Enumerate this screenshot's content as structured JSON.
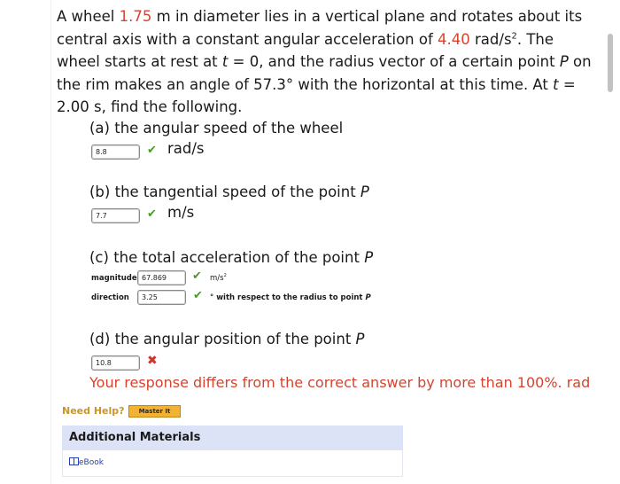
{
  "problem": {
    "p1": "A wheel ",
    "diameter": "1.75",
    "p2": " m in diameter lies in a vertical plane and rotates about its central axis with a constant angular acceleration of ",
    "alpha": "4.40",
    "p3": " rad/s",
    "p3_sup": "2",
    "p4": ". The wheel starts at rest at ",
    "t_var": "t",
    "p5": " = 0, and the radius vector of a certain point ",
    "P1": "P",
    "p6": " on the rim makes an angle of 57.3° with the horizontal at this time. At ",
    "t_var2": "t",
    "p7": " = 2.00 s, find the following."
  },
  "parts": {
    "a": {
      "label": "(a) the angular speed of the wheel",
      "value": "8.8",
      "unit": "rad/s"
    },
    "b": {
      "label_pre": "(b) the tangential speed of the point ",
      "label_var": "P",
      "value": "7.7",
      "unit": "m/s"
    },
    "c": {
      "label_pre": "(c) the total acceleration of the point ",
      "label_var": "P",
      "magnitude_label": "magnitude",
      "magnitude_value": "67.869",
      "magnitude_unit": "m/s",
      "magnitude_unit_sup": "2",
      "direction_label": "direction",
      "direction_value": "3.25",
      "direction_unit": "° with respect to the radius to point ",
      "direction_var": "P"
    },
    "d": {
      "label_pre": "(d) the angular position of the point ",
      "label_var": "P",
      "value": "10.8",
      "response": "Your response differs from the correct answer by more than 100%. rad"
    }
  },
  "help": {
    "need_help": "Need Help?",
    "master_it": "Master It"
  },
  "additional": {
    "title": "Additional Materials",
    "ebook": "eBook"
  },
  "colors": {
    "highlight_red": "#d4442f",
    "check_green": "#4a9a2a",
    "cross_red": "#d0342c",
    "help_gold": "#c9962c",
    "master_bg": "#f2b233",
    "panel_bg": "#dde3f6"
  },
  "icons": {
    "correct": "check-icon",
    "incorrect": "cross-icon",
    "ebook": "book-icon"
  }
}
